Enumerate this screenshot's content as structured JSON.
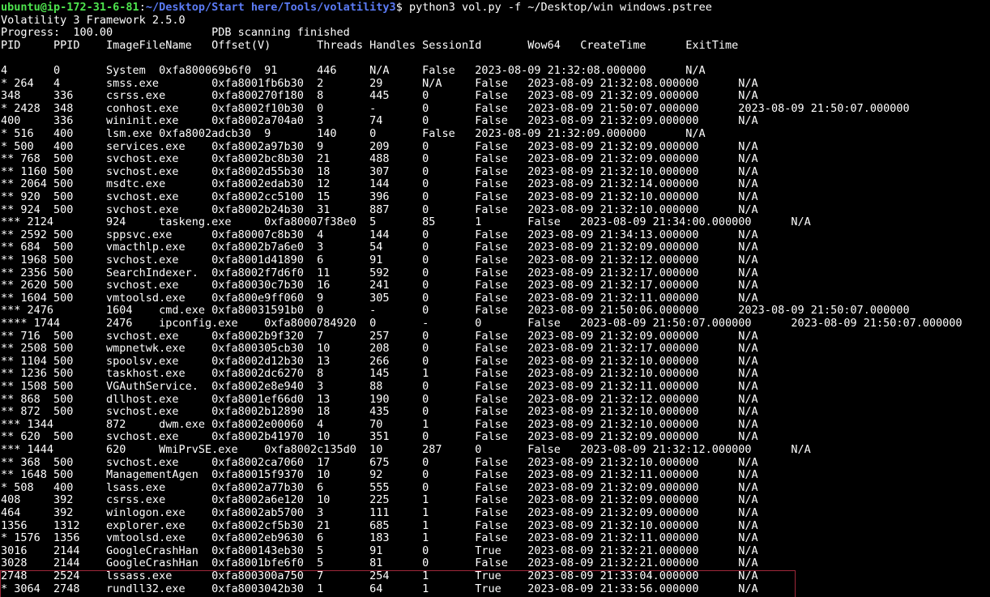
{
  "prompt": {
    "user_host": "ubuntu@ip-172-31-6-81",
    "separator": ":",
    "path": "~/Desktop/Start here/Tools/volatility3",
    "symbol": "$ ",
    "command": "python3 vol.py -f ~/Desktop/win windows.pstree"
  },
  "banner": "Volatility 3 Framework 2.5.0",
  "progress": "Progress:  100.00               PDB scanning finished",
  "header": "PID     PPID    ImageFileName   Offset(V)       Threads Handles SessionId       Wow64   CreateTime      ExitTime",
  "rows": [
    "4       0       System  0xfa800069b6f0  91      446     N/A     False   2023-08-09 21:32:08.000000      N/A",
    "* 264   4       smss.exe        0xfa8001fb6b30  2       29      N/A     False   2023-08-09 21:32:08.000000      N/A",
    "348     336     csrss.exe       0xfa800270f180  8       445     0       False   2023-08-09 21:32:09.000000      N/A",
    "* 2428  348     conhost.exe     0xfa8002f10b30  0       -       0       False   2023-08-09 21:50:07.000000      2023-08-09 21:50:07.000000",
    "400     336     wininit.exe     0xfa8002a704a0  3       74      0       False   2023-08-09 21:32:09.000000      N/A",
    "* 516   400     lsm.exe 0xfa8002adcb30  9       140     0       False   2023-08-09 21:32:09.000000      N/A",
    "* 500   400     services.exe    0xfa8002a97b30  9       209     0       False   2023-08-09 21:32:09.000000      N/A",
    "** 768  500     svchost.exe     0xfa8002bc8b30  21      488     0       False   2023-08-09 21:32:09.000000      N/A",
    "** 1160 500     svchost.exe     0xfa8002d55b30  18      307     0       False   2023-08-09 21:32:10.000000      N/A",
    "** 2064 500     msdtc.exe       0xfa8002edab30  12      144     0       False   2023-08-09 21:32:14.000000      N/A",
    "** 920  500     svchost.exe     0xfa8002cc5100  15      396     0       False   2023-08-09 21:32:10.000000      N/A",
    "** 924  500     svchost.exe     0xfa8002b24b30  31      887     0       False   2023-08-09 21:32:10.000000      N/A",
    "*** 2124        924     taskeng.exe     0xfa80007f38e0  5       85      1       False   2023-08-09 21:34:00.000000      N/A",
    "** 2592 500     sppsvc.exe      0xfa80007c8b30  4       144     0       False   2023-08-09 21:34:13.000000      N/A",
    "** 684  500     vmacthlp.exe    0xfa8002b7a6e0  3       54      0       False   2023-08-09 21:32:09.000000      N/A",
    "** 1968 500     svchost.exe     0xfa8001d41890  6       91      0       False   2023-08-09 21:32:12.000000      N/A",
    "** 2356 500     SearchIndexer.  0xfa8002f7d6f0  11      592     0       False   2023-08-09 21:32:17.000000      N/A",
    "** 2620 500     svchost.exe     0xfa80030c7b30  16      241     0       False   2023-08-09 21:32:17.000000      N/A",
    "** 1604 500     vmtoolsd.exe    0xfa800e9ff060  9       305     0       False   2023-08-09 21:32:11.000000      N/A",
    "*** 2476        1604    cmd.exe 0xfa80031591b0  0       -       0       False   2023-08-09 21:50:06.000000      2023-08-09 21:50:07.000000",
    "**** 1744       2476    ipconfig.exe    0xfa8000784920  0       -       0       False   2023-08-09 21:50:07.000000      2023-08-09 21:50:07.000000",
    "** 716  500     svchost.exe     0xfa8002b9f320  7       257     0       False   2023-08-09 21:32:09.000000      N/A",
    "** 2508 500     wmpnetwk.exe    0xfa800305cb30  10      208     0       False   2023-08-09 21:32:17.000000      N/A",
    "** 1104 500     spoolsv.exe     0xfa8002d12b30  13      266     0       False   2023-08-09 21:32:10.000000      N/A",
    "** 1236 500     taskhost.exe    0xfa8002dc6270  8       145     1       False   2023-08-09 21:32:10.000000      N/A",
    "** 1508 500     VGAuthService.  0xfa8002e8e940  3       88      0       False   2023-08-09 21:32:11.000000      N/A",
    "** 868  500     dllhost.exe     0xfa8001ef66d0  13      190     0       False   2023-08-09 21:32:12.000000      N/A",
    "** 872  500     svchost.exe     0xfa8002b12890  18      435     0       False   2023-08-09 21:32:10.000000      N/A",
    "*** 1344        872     dwm.exe 0xfa8002e00060  4       70      1       False   2023-08-09 21:32:10.000000      N/A",
    "** 620  500     svchost.exe     0xfa8002b41970  10      351     0       False   2023-08-09 21:32:09.000000      N/A",
    "*** 1444        620     WmiPrvSE.exe    0xfa8002c135d0  10      287     0       False   2023-08-09 21:32:12.000000      N/A",
    "** 368  500     svchost.exe     0xfa8002ca7060  17      675     0       False   2023-08-09 21:32:10.000000      N/A",
    "** 1648 500     ManagementAgen  0xfa80015f9370  10      92      0       False   2023-08-09 21:32:11.000000      N/A",
    "* 508   400     lsass.exe       0xfa8002a77b30  6       555     0       False   2023-08-09 21:32:09.000000      N/A",
    "408     392     csrss.exe       0xfa8002a6e120  10      225     1       False   2023-08-09 21:32:09.000000      N/A",
    "464     392     winlogon.exe    0xfa8002ab5700  3       111     1       False   2023-08-09 21:32:09.000000      N/A",
    "1356    1312    explorer.exe    0xfa8002cf5b30  21      685     1       False   2023-08-09 21:32:10.000000      N/A",
    "* 1576  1356    vmtoolsd.exe    0xfa8002eb9630  6       183     1       False   2023-08-09 21:32:11.000000      N/A",
    "3016    2144    GoogleCrashHan  0xfa800143eb30  5       91      0       True    2023-08-09 21:32:21.000000      N/A",
    "3028    2144    GoogleCrashHan  0xfa8001bfe6f0  5       81      0       False   2023-08-09 21:32:21.000000      N/A",
    "2748    2524    lssass.exe      0xfa800300a750  7       254     1       True    2023-08-09 21:33:04.000000      N/A",
    "* 3064  2748    rundll32.exe    0xfa8003042b30  1       64      1       True    2023-08-09 21:33:56.000000      N/A"
  ],
  "colors": {
    "background": "#000000",
    "text": "#ffffff",
    "prompt_user": "#4ee44e",
    "prompt_path": "#5b7bf5",
    "highlight_border": "#a0283a"
  }
}
